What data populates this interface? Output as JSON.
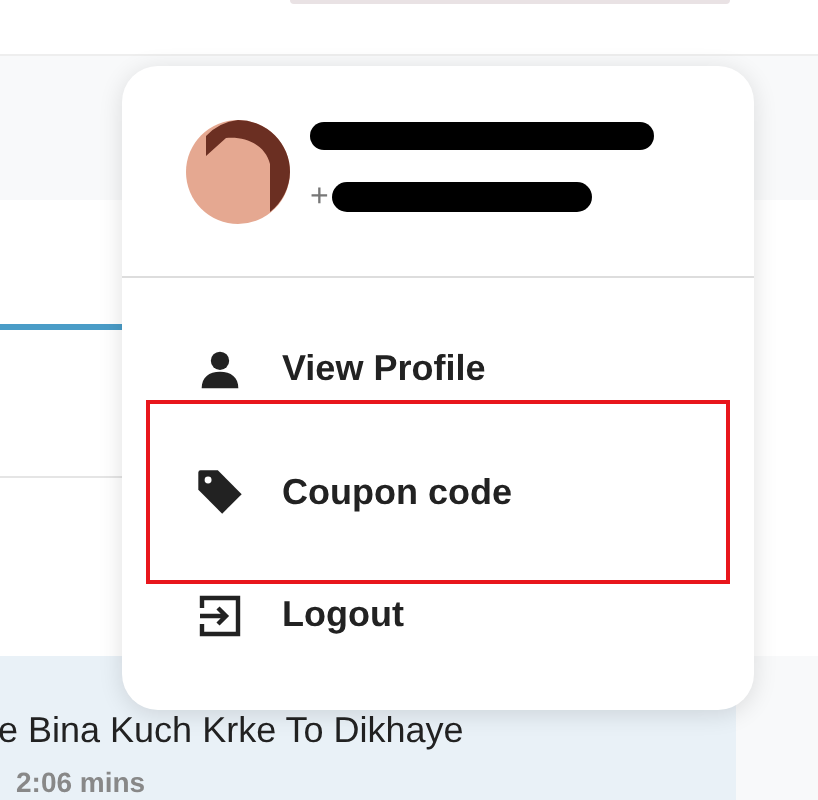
{
  "profile": {
    "phone_prefix": "+"
  },
  "menu_items": [
    {
      "label": "View Profile",
      "kind": "user",
      "highlighted": false
    },
    {
      "label": "Coupon code",
      "kind": "tag",
      "highlighted": true
    },
    {
      "label": "Logout",
      "kind": "logout",
      "highlighted": false
    }
  ],
  "list_item": {
    "title": "e Bina Kuch Krke To Dikhaye",
    "duration": "2:06 mins"
  }
}
